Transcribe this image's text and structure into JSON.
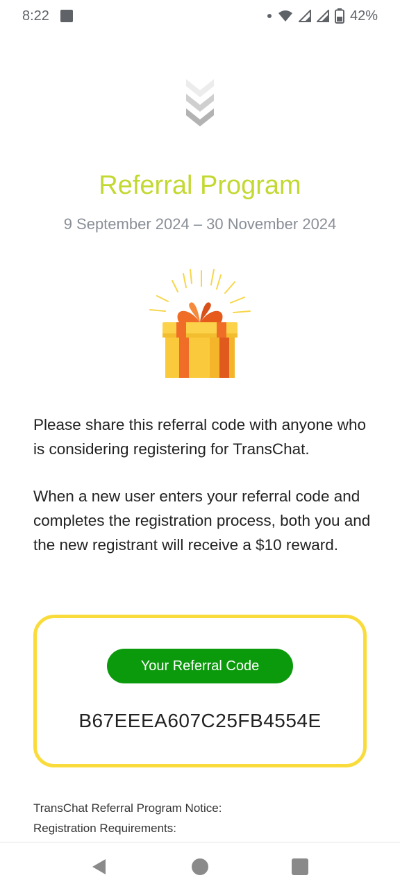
{
  "status_bar": {
    "time": "8:22",
    "battery_percent": "42%",
    "icons": [
      "notification-square-icon",
      "dot-icon",
      "wifi-icon",
      "signal-icon",
      "signal-icon",
      "battery-icon"
    ]
  },
  "header": {
    "scroll_hint_icon": "chevrons-down-icon",
    "title": "Referral Program",
    "date_range": "9 September 2024  –  30 November 2024"
  },
  "hero": {
    "icon": "gift-icon"
  },
  "body": {
    "paragraph_1": "Please share this referral code with anyone who is considering registering for TransChat.",
    "paragraph_2": "When a new user enters your referral code and completes the registration process, both you and the new registrant will receive a $10 reward."
  },
  "referral": {
    "label": "Your Referral Code",
    "code": "B67EEEA607C25FB4554E"
  },
  "notice": {
    "title": "TransChat Referral Program Notice:",
    "subtitle": "Registration Requirements:"
  },
  "nav_bar": {
    "icons": [
      "back-icon",
      "home-icon",
      "recents-icon"
    ]
  },
  "colors": {
    "title": "#c3d831",
    "pill": "#0b9a0b",
    "card_border": "#f9dc3c",
    "date_text": "#8a8f97"
  }
}
